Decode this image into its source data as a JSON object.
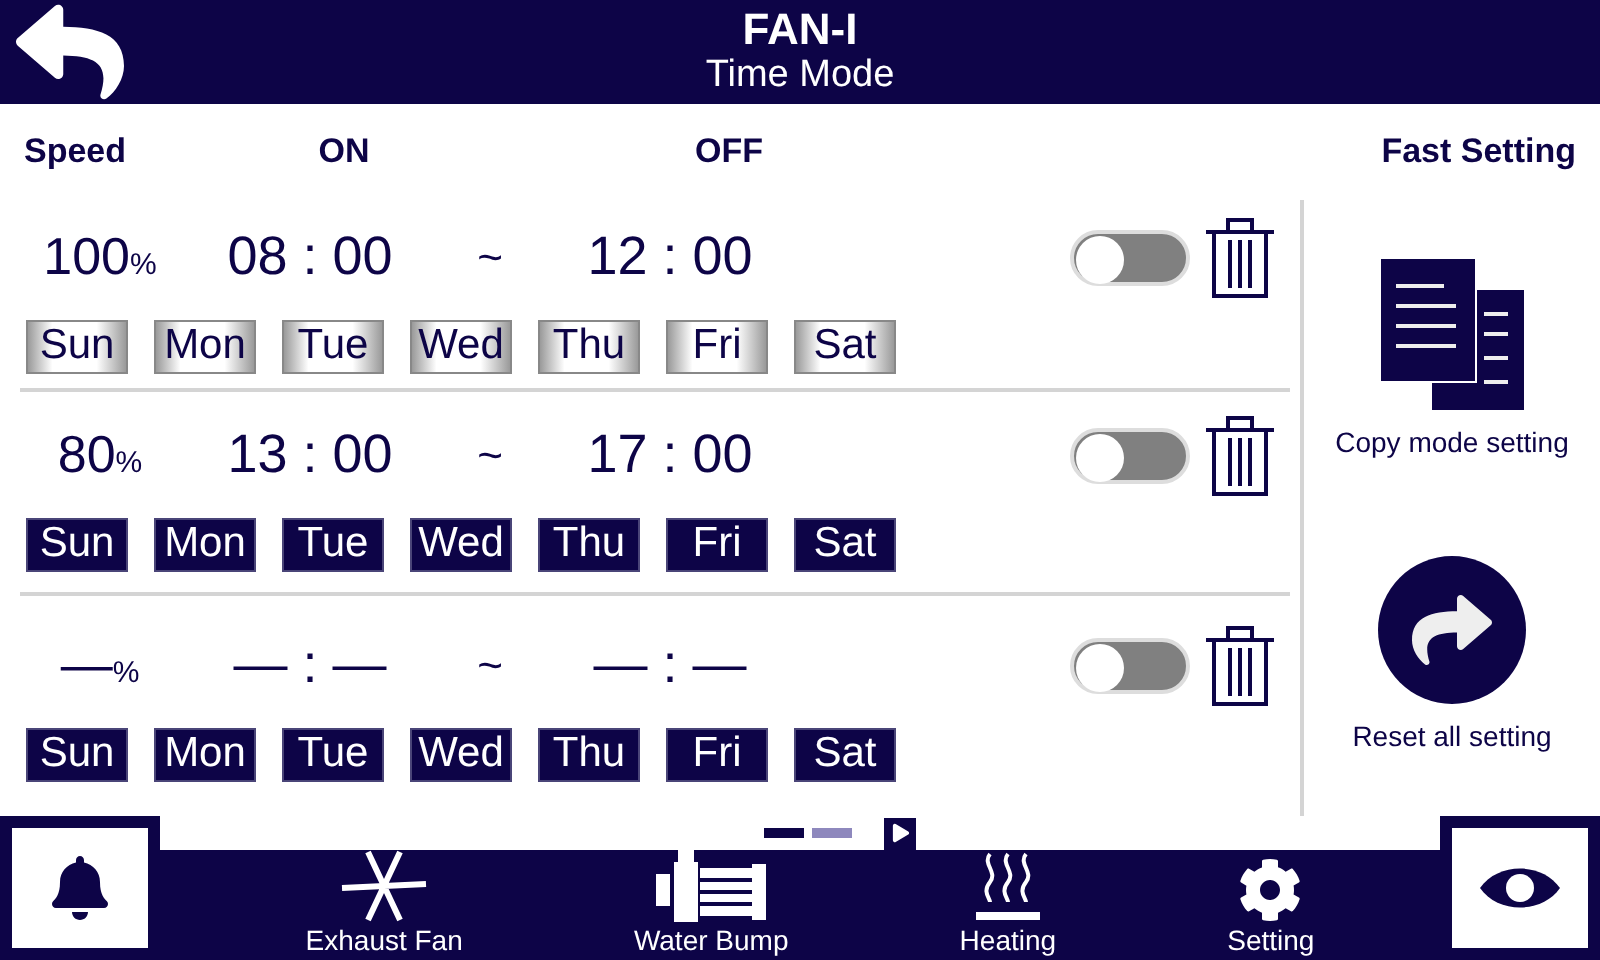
{
  "header": {
    "title": "FAN-I",
    "subtitle": "Time Mode"
  },
  "columns": {
    "speed": "Speed",
    "on": "ON",
    "off": "OFF"
  },
  "schedules": [
    {
      "speed": "100",
      "unit": "%",
      "on": "08 : 00",
      "separator": "~",
      "off": "12 : 00",
      "enabled": false,
      "days": [
        {
          "label": "Sun",
          "selected": false
        },
        {
          "label": "Mon",
          "selected": false
        },
        {
          "label": "Tue",
          "selected": false
        },
        {
          "label": "Wed",
          "selected": false
        },
        {
          "label": "Thu",
          "selected": false
        },
        {
          "label": "Fri",
          "selected": false
        },
        {
          "label": "Sat",
          "selected": false
        }
      ]
    },
    {
      "speed": "80",
      "unit": "%",
      "on": "13 : 00",
      "separator": "~",
      "off": "17 : 00",
      "enabled": false,
      "days": [
        {
          "label": "Sun",
          "selected": true
        },
        {
          "label": "Mon",
          "selected": true
        },
        {
          "label": "Tue",
          "selected": true
        },
        {
          "label": "Wed",
          "selected": true
        },
        {
          "label": "Thu",
          "selected": true
        },
        {
          "label": "Fri",
          "selected": true
        },
        {
          "label": "Sat",
          "selected": true
        }
      ]
    },
    {
      "speed": "—",
      "unit": "%",
      "on": "— : —",
      "separator": "~",
      "off": "— : —",
      "enabled": false,
      "days": [
        {
          "label": "Sun",
          "selected": true
        },
        {
          "label": "Mon",
          "selected": true
        },
        {
          "label": "Tue",
          "selected": true
        },
        {
          "label": "Wed",
          "selected": true
        },
        {
          "label": "Thu",
          "selected": true
        },
        {
          "label": "Fri",
          "selected": true
        },
        {
          "label": "Sat",
          "selected": true
        }
      ]
    }
  ],
  "fast_setting": {
    "title": "Fast Setting",
    "actions": [
      {
        "kind": "copy",
        "label": "Copy mode setting"
      },
      {
        "kind": "reset",
        "label": "Reset all setting"
      }
    ]
  },
  "pager": {
    "pages": [
      {
        "selected": true
      },
      {
        "selected": false
      }
    ]
  },
  "nav": [
    {
      "kind": "fan",
      "label": "Exhaust Fan"
    },
    {
      "kind": "pump",
      "label": "Water Bump"
    },
    {
      "kind": "heating",
      "label": "Heating"
    },
    {
      "kind": "setting",
      "label": "Setting"
    }
  ]
}
